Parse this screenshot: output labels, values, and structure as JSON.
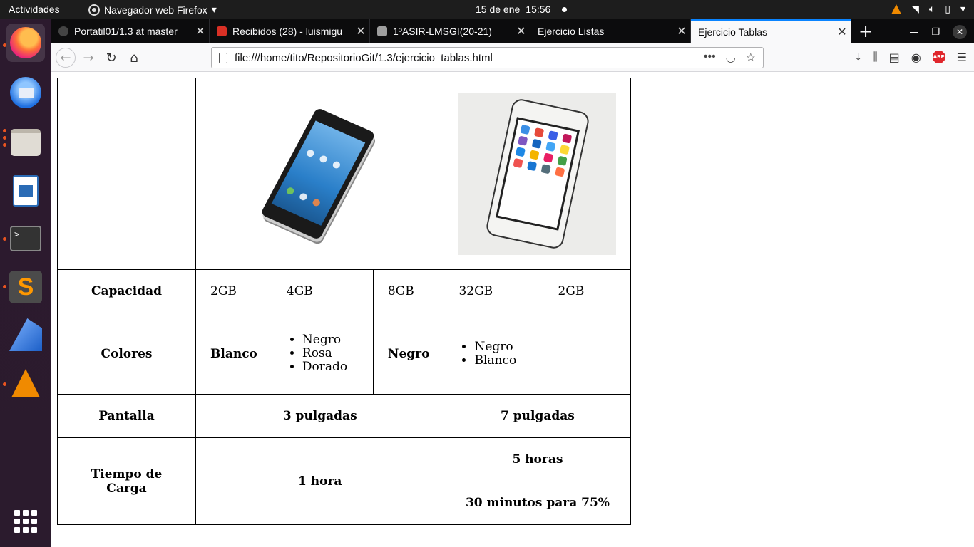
{
  "desktop": {
    "activities": "Actividades",
    "app_menu": "Navegador web Firefox",
    "date": "15 de ene",
    "time": "15:56"
  },
  "browser": {
    "tabs": [
      {
        "label": "Portatil01/1.3 at master",
        "favicon_color": "#444444"
      },
      {
        "label": "Recibidos (28) - luismigu",
        "favicon_color": "#d93025"
      },
      {
        "label": "1ºASIR-LMSGI(20-21)",
        "favicon_color": "#9e9e9e"
      },
      {
        "label": "Ejercicio Listas",
        "favicon_color": ""
      },
      {
        "label": "Ejercicio Tablas",
        "favicon_color": ""
      }
    ],
    "url": "file:///home/tito/RepositorioGit/1.3/ejercicio_tablas.html"
  },
  "table": {
    "capacidad_label": "Capacidad",
    "capacities": [
      "2GB",
      "4GB",
      "8GB",
      "32GB",
      "2GB"
    ],
    "colores_label": "Colores",
    "phone1_color_a": "Blanco",
    "phone1_colors_list": [
      "Negro",
      "Rosa",
      "Dorado"
    ],
    "phone1_color_b": "Negro",
    "phone2_colors_list": [
      "Negro",
      "Blanco"
    ],
    "pantalla_label": "Pantalla",
    "pantalla_phone1": "3 pulgadas",
    "pantalla_phone2": "7 pulgadas",
    "carga_label": "Tiempo de Carga",
    "carga_phone1": "1 hora",
    "carga_phone2_a": "5 horas",
    "carga_phone2_b": "30 minutos para 75%"
  }
}
